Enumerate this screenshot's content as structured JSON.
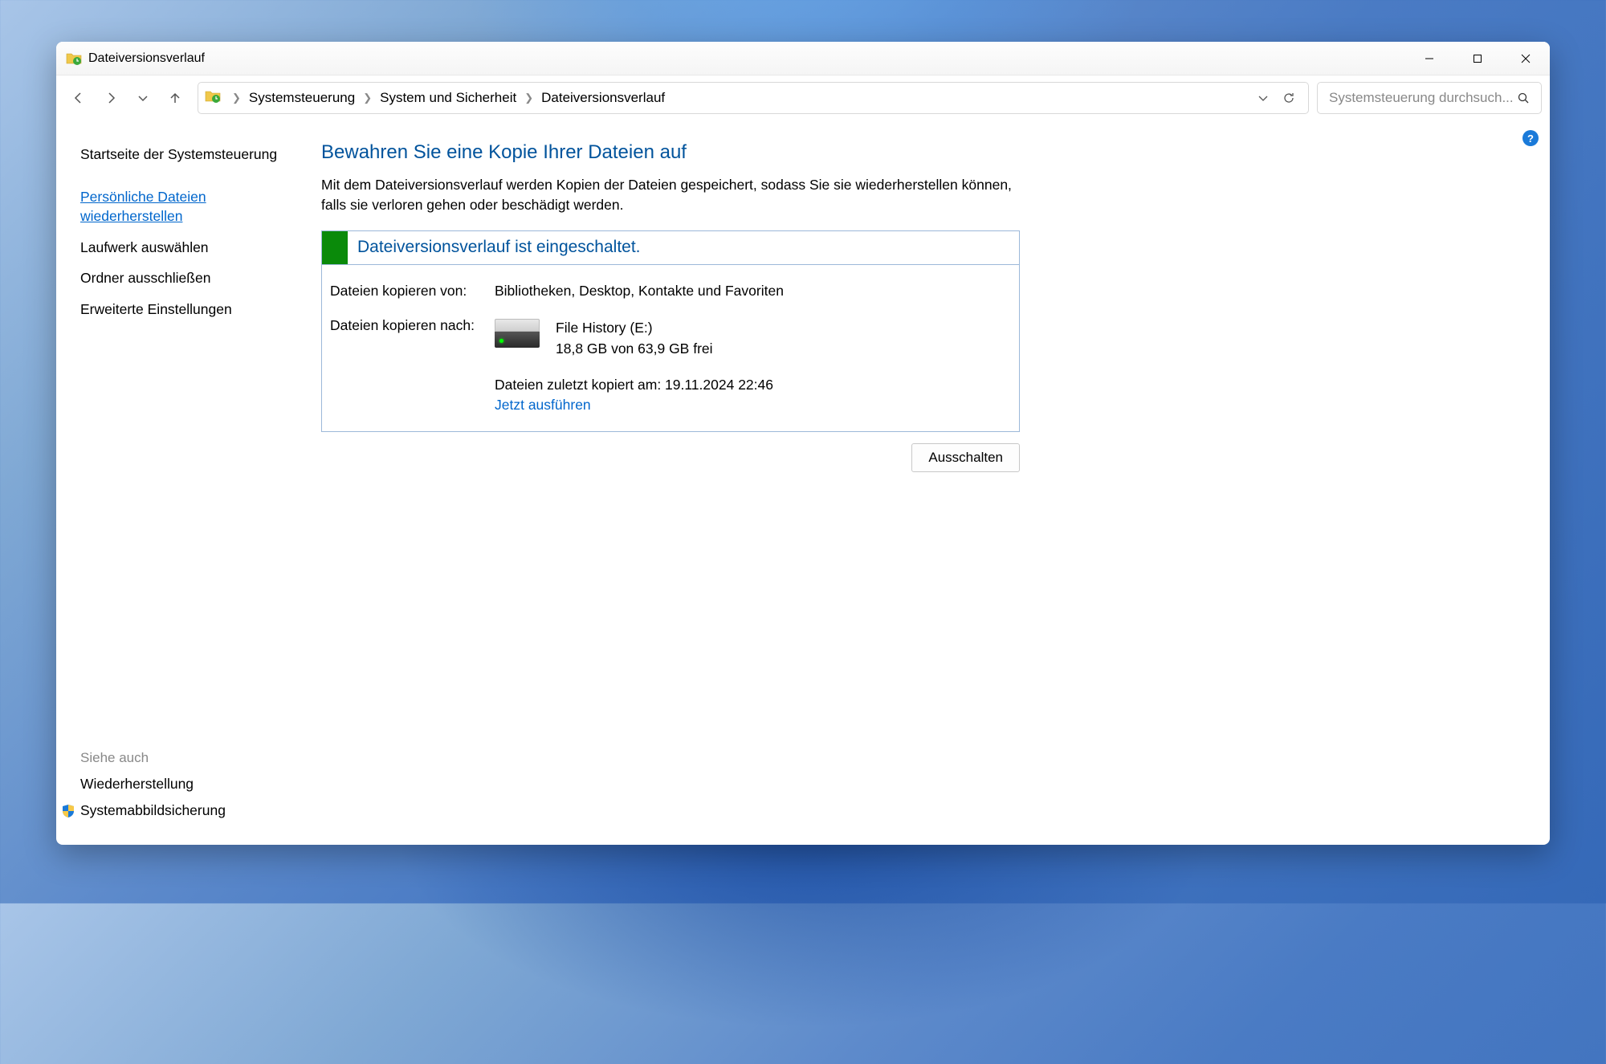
{
  "window": {
    "title": "Dateiversionsverlauf"
  },
  "breadcrumb": {
    "items": [
      "Systemsteuerung",
      "System und Sicherheit",
      "Dateiversionsverlauf"
    ]
  },
  "search": {
    "placeholder": "Systemsteuerung durchsuch..."
  },
  "sidebar": {
    "home": "Startseite der Systemsteuerung",
    "items": [
      "Persönliche Dateien wiederherstellen",
      "Laufwerk auswählen",
      "Ordner ausschließen",
      "Erweiterte Einstellungen"
    ],
    "see_also_label": "Siehe auch",
    "see_also": [
      "Wiederherstellung",
      "Systemabbildsicherung"
    ]
  },
  "main": {
    "heading": "Bewahren Sie eine Kopie Ihrer Dateien auf",
    "description": "Mit dem Dateiversionsverlauf werden Kopien der Dateien gespeichert, sodass Sie sie wiederherstellen können, falls sie verloren gehen oder beschädigt werden.",
    "status_title": "Dateiversionsverlauf ist eingeschaltet.",
    "copy_from_label": "Dateien kopieren von:",
    "copy_from_value": "Bibliotheken, Desktop, Kontakte und Favoriten",
    "copy_to_label": "Dateien kopieren nach:",
    "drive_name": "File History (E:)",
    "drive_space": "18,8 GB von 63,9 GB frei",
    "last_copy": "Dateien zuletzt kopiert am: 19.11.2024 22:46",
    "run_now": "Jetzt ausführen",
    "turn_off": "Ausschalten"
  },
  "help_badge": "?"
}
